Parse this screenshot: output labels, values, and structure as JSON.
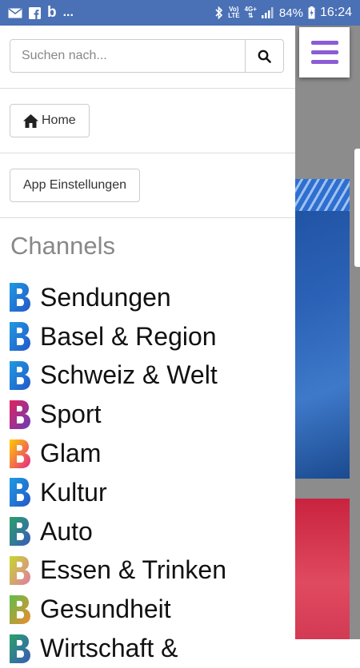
{
  "status_bar": {
    "left_icons": [
      "mail-icon",
      "facebook-icon",
      "b-app-icon"
    ],
    "overflow": "...",
    "bluetooth": "bluetooth-icon",
    "volte_top": "Vo)",
    "volte_bottom": "LTE",
    "network_top": "4G+",
    "battery_percent": "84%",
    "time": "16:24"
  },
  "search": {
    "placeholder": "Suchen nach..."
  },
  "home_button": {
    "label": "Home"
  },
  "settings_button": {
    "label": "App Einstellungen"
  },
  "channels": {
    "title": "Channels",
    "items": [
      {
        "label": "Sendungen",
        "colors": [
          "#1f9ae0",
          "#2457c9"
        ]
      },
      {
        "label": "Basel & Region",
        "colors": [
          "#1f9ae0",
          "#2457c9"
        ]
      },
      {
        "label": "Schweiz & Welt",
        "colors": [
          "#1f9ae0",
          "#2457c9"
        ]
      },
      {
        "label": "Sport",
        "colors": [
          "#e0245e",
          "#6a3bb8"
        ]
      },
      {
        "label": "Glam",
        "colors": [
          "#ffcc00",
          "#e6248a"
        ]
      },
      {
        "label": "Kultur",
        "colors": [
          "#1f9ae0",
          "#2457c9"
        ]
      },
      {
        "label": "Auto",
        "colors": [
          "#2aa06a",
          "#3a5bb8"
        ]
      },
      {
        "label": "Essen & Trinken",
        "colors": [
          "#c6d82a",
          "#e07aa8"
        ]
      },
      {
        "label": "Gesundheit",
        "colors": [
          "#5bbf4a",
          "#f08a30"
        ]
      },
      {
        "label": "Wirtschaft &",
        "colors": [
          "#2aa06a",
          "#3a5bb8"
        ]
      }
    ]
  }
}
